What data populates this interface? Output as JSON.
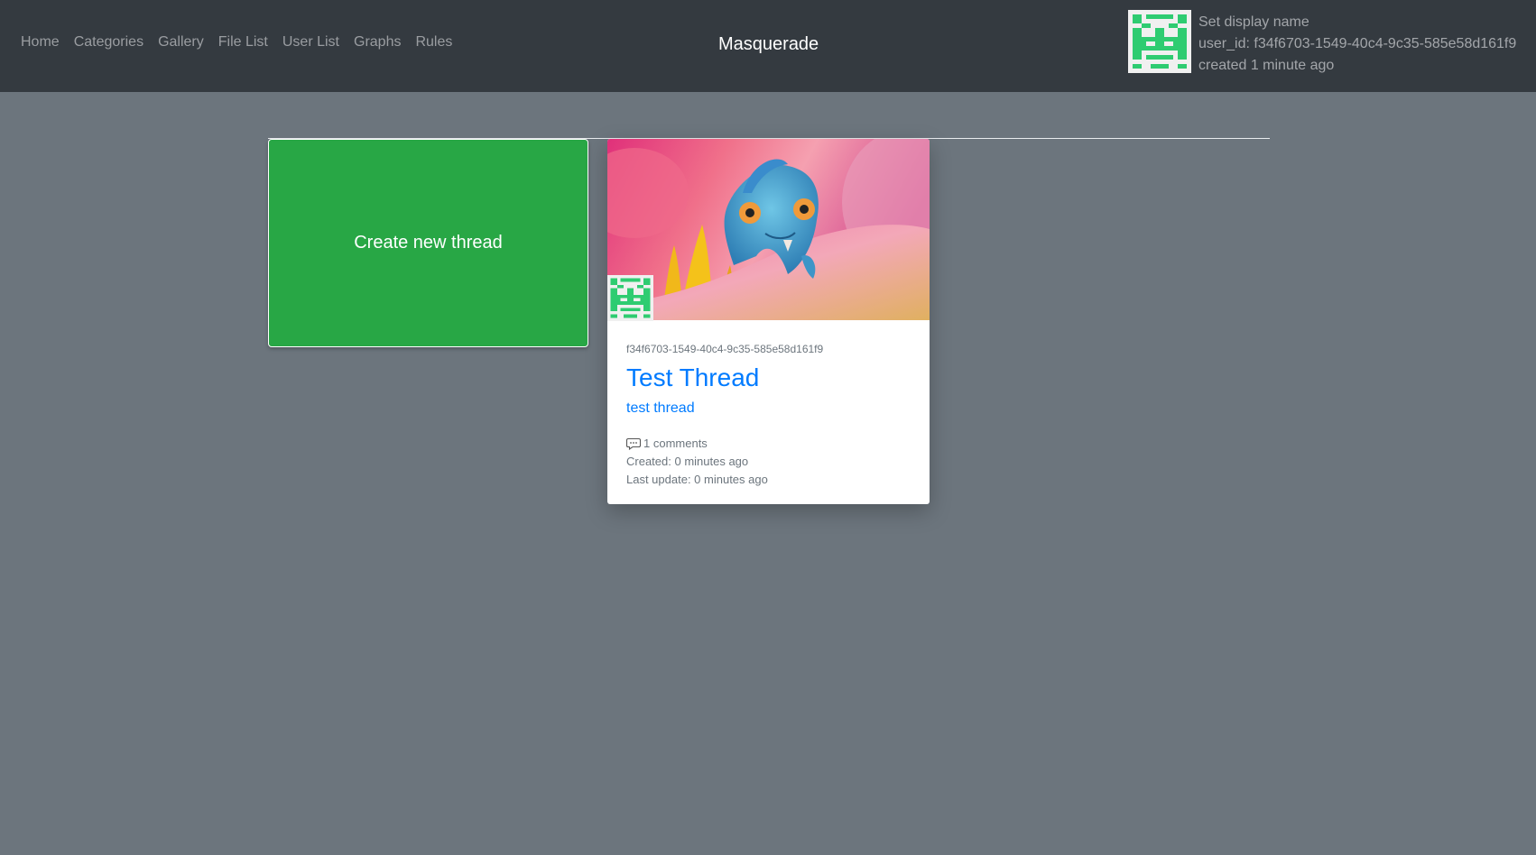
{
  "nav": {
    "links": [
      {
        "label": "Home"
      },
      {
        "label": "Categories"
      },
      {
        "label": "Gallery"
      },
      {
        "label": "File List"
      },
      {
        "label": "User List"
      },
      {
        "label": "Graphs"
      },
      {
        "label": "Rules"
      }
    ],
    "brand": "Masquerade"
  },
  "user": {
    "set_display_name": "Set display name",
    "user_id_line": "user_id: f34f6703-1549-40c4-9c35-585e58d161f9",
    "created_line": "created 1 minute ago",
    "avatar_icon": "identicon-avatar-icon",
    "avatar_color": "#2ecc71"
  },
  "actions": {
    "create_thread_label": "Create new thread",
    "create_thread_color": "#28a745"
  },
  "threads": [
    {
      "author_id": "f34f6703-1549-40c4-9c35-585e58d161f9",
      "title": "Test Thread",
      "subtitle": "test thread",
      "comments": "1 comments",
      "created": "Created: 0 minutes ago",
      "last_update": "Last update: 0 minutes ago",
      "image_icon": "chameleon-on-flower-image",
      "link_color": "#007bff"
    }
  ]
}
